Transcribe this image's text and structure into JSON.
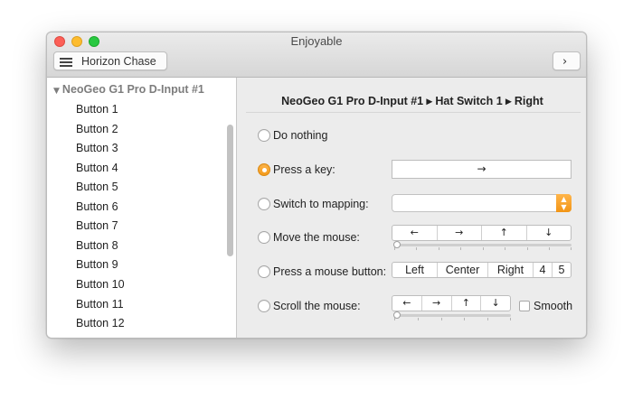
{
  "window": {
    "title": "Enjoyable"
  },
  "toolbar": {
    "profile_name": "Horizon Chase",
    "next_icon": "›"
  },
  "sidebar": {
    "device_name": "NeoGeo G1 Pro D-Input #1",
    "expand_icon": "▼",
    "items": [
      {
        "label": "Button 1"
      },
      {
        "label": "Button 2"
      },
      {
        "label": "Button 3"
      },
      {
        "label": "Button 4"
      },
      {
        "label": "Button 5"
      },
      {
        "label": "Button 6"
      },
      {
        "label": "Button 7"
      },
      {
        "label": "Button 8"
      },
      {
        "label": "Button 9"
      },
      {
        "label": "Button 10"
      },
      {
        "label": "Button 11"
      },
      {
        "label": "Button 12"
      }
    ]
  },
  "main": {
    "path_title": "NeoGeo G1 Pro D-Input #1 ▸ Hat Switch 1 ▸ Right",
    "selected_option": "press_key",
    "options": {
      "do_nothing": "Do nothing",
      "press_key": "Press a key:",
      "switch_mapping": "Switch to mapping:",
      "move_mouse": "Move the mouse:",
      "press_mouse_button": "Press a mouse button:",
      "scroll_mouse": "Scroll the mouse:"
    },
    "key_value": "→",
    "mapping_value": "",
    "move_directions": [
      "←",
      "→",
      "↑",
      "↓"
    ],
    "move_speed": 0,
    "mouse_buttons": [
      "Left",
      "Center",
      "Right",
      "4",
      "5"
    ],
    "scroll_directions": [
      "←",
      "→",
      "↑",
      "↓"
    ],
    "scroll_speed": 0,
    "smooth_label": "Smooth",
    "smooth_checked": false
  },
  "colors": {
    "accent": "#f5a425",
    "window_bg": "#ececec"
  }
}
